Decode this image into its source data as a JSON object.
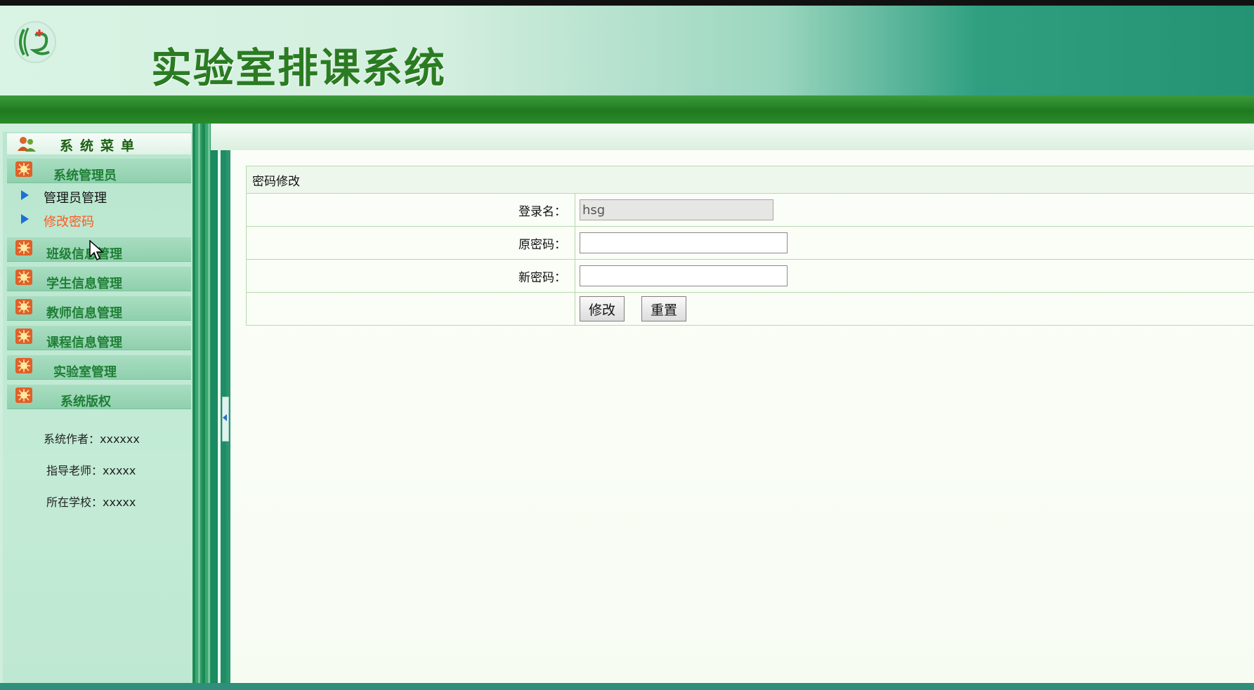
{
  "header": {
    "title": "实验室排课系统"
  },
  "sidebar": {
    "menu_title": "系统菜单",
    "sections": [
      {
        "label": "系统管理员",
        "items": [
          {
            "label": "管理员管理",
            "active": false
          },
          {
            "label": "修改密码",
            "active": true
          }
        ]
      },
      {
        "label": "班级信息管理"
      },
      {
        "label": "学生信息管理"
      },
      {
        "label": "教师信息管理"
      },
      {
        "label": "课程信息管理"
      },
      {
        "label": "实验室管理"
      },
      {
        "label": "系统版权"
      }
    ],
    "copyright": {
      "author": "系统作者：xxxxxx",
      "teacher": "指导老师：xxxxx",
      "school": "所在学校：xxxxx"
    }
  },
  "form": {
    "caption": "密码修改",
    "login_label": "登录名：",
    "login_value": "hsg",
    "old_pwd_label": "原密码：",
    "new_pwd_label": "新密码：",
    "submit_label": "修改",
    "reset_label": "重置"
  },
  "colors": {
    "brand_green": "#2a7b21",
    "active_link": "#ff5a1e"
  }
}
